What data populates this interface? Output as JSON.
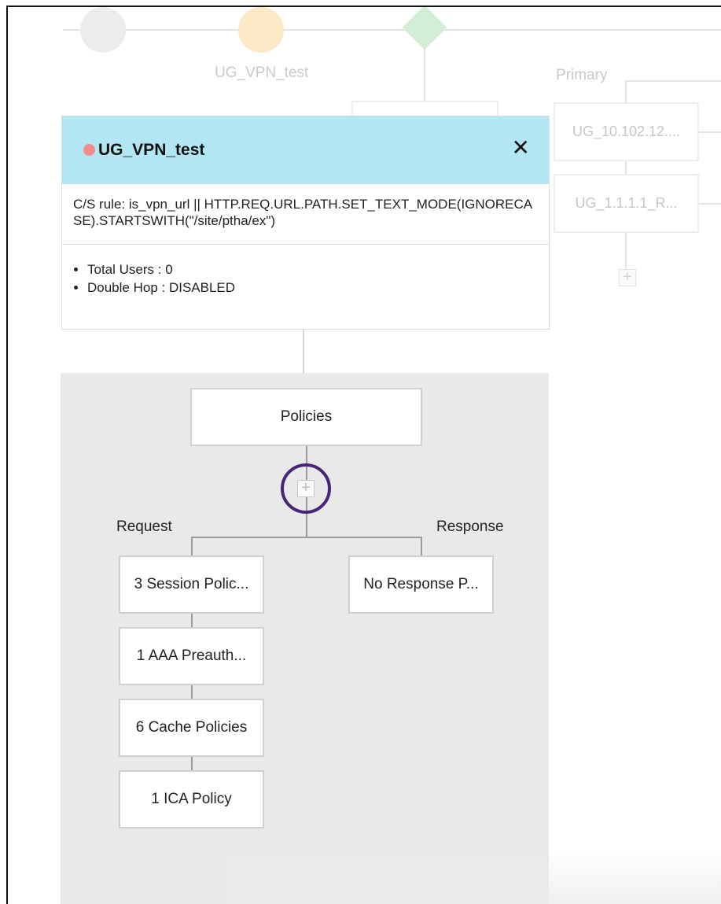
{
  "flow": {
    "node_label": "UG_VPN_test",
    "primary_label": "Primary",
    "server_boxes": [
      "UG_10.102.12....",
      "UG_1.1.1.1_R..."
    ],
    "add_symbol": "+"
  },
  "card": {
    "title": "UG_VPN_test",
    "close_symbol": "✕",
    "rule": "C/S rule: is_vpn_url || HTTP.REQ.URL.PATH.SET_TEXT_MODE(IGNORECASE).STARTSWITH(\"/site/ptha/ex\")",
    "stats": [
      "Total Users : 0",
      "Double Hop : DISABLED"
    ],
    "status_color": "#f28b8b",
    "header_color": "#b2e6f2"
  },
  "policies": {
    "title": "Policies",
    "add_symbol": "+",
    "request_label": "Request",
    "response_label": "Response",
    "request_items": [
      "3 Session Polic...",
      "1 AAA Preauth...",
      "6 Cache Policies",
      "1 ICA Policy"
    ],
    "response_items": [
      "No Response P..."
    ],
    "highlight_color": "#4a2478"
  }
}
